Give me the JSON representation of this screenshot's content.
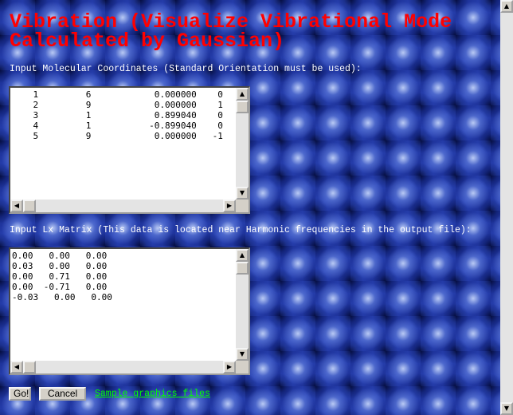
{
  "title": "Vibration (Visualize Vibrational Mode\nCalculated by Gaussian)",
  "coords": {
    "label": "Input Molecular Coordinates (Standard Orientation must be used):",
    "value": "    1         6            0.000000    0\n    2         9            0.000000    1\n    3         1            0.899040    0\n    4         1           -0.899040    0\n    5         9            0.000000   -1"
  },
  "lx": {
    "label": "Input Lx Matrix (This data is located near Harmonic frequencies in the output file):",
    "value": "0.00   0.00   0.00\n0.03   0.00   0.00\n0.00   0.71   0.00\n0.00  -0.71   0.00\n-0.03   0.00   0.00"
  },
  "buttons": {
    "go": "Go!",
    "cancel": "Cancel"
  },
  "link": "Sample graphics files",
  "icons": {
    "up": "▲",
    "down": "▼",
    "left": "◀",
    "right": "▶"
  },
  "colors": {
    "title": "#ff0000",
    "link": "#00ff00",
    "label": "#ffffff"
  }
}
